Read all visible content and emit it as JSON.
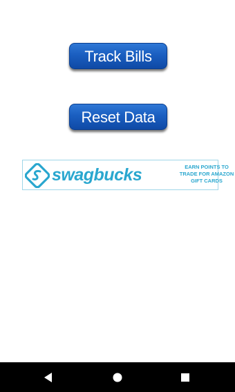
{
  "buttons": {
    "track_bills": "Track Bills",
    "reset_data": "Reset Data"
  },
  "ad": {
    "brand": "swagbucks",
    "tagline": [
      "EARN POINTS TO",
      "TRADE FOR AMAZON",
      "GIFT CARDS"
    ],
    "logo_icon": "swagbucks-logo-icon",
    "accent_color": "#2aa7cf"
  },
  "navigation_bar": {
    "back_icon": "back-triangle-icon",
    "home_icon": "home-circle-icon",
    "recents_icon": "recents-square-icon"
  },
  "colors": {
    "button_blue": "#1a5ec0",
    "navbar": "#000000",
    "background": "#ffffff"
  }
}
